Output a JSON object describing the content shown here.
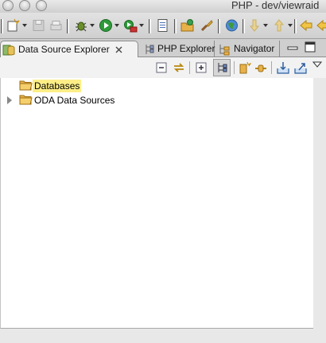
{
  "window": {
    "title": "PHP - dev/viewraid"
  },
  "toolbar": {
    "icons": [
      "new-wizard-icon",
      "save-icon",
      "print-icon",
      "debug-icon",
      "run-icon",
      "external-tools-icon",
      "task-list-icon",
      "open-type-icon",
      "search-icon",
      "web-browser-icon",
      "next-annotation-icon",
      "previous-annotation-icon",
      "back-icon",
      "forward-icon"
    ]
  },
  "tabs": [
    {
      "label": "Data Source Explorer",
      "icon": "data-source-explorer-icon",
      "active": true
    },
    {
      "label": "PHP Explorer",
      "icon": "php-explorer-icon",
      "active": false
    },
    {
      "label": "Navigator",
      "icon": "navigator-icon",
      "active": false
    }
  ],
  "view_toolbar": {
    "icons": [
      "collapse-all-icon",
      "link-with-editor-icon",
      "expand-all-icon",
      "show-tree-icon",
      "new-connection-profile-icon",
      "connect-icon",
      "import-icon",
      "export-icon",
      "view-menu-icon"
    ]
  },
  "tree": {
    "items": [
      {
        "label": "Databases",
        "icon": "folder-icon",
        "selected": true,
        "expandable": false
      },
      {
        "label": "ODA Data Sources",
        "icon": "folder-icon",
        "selected": false,
        "expandable": true
      }
    ]
  },
  "colors": {
    "selection": "#fdee87",
    "folder": "#e7b24a"
  }
}
